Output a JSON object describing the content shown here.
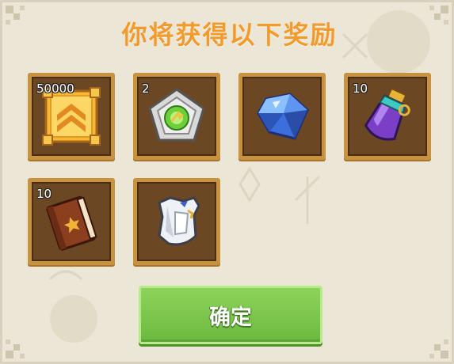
{
  "dialog": {
    "title": "你将获得以下奖励"
  },
  "rewards": [
    {
      "icon": "gold-insignia-icon",
      "count": "50000"
    },
    {
      "icon": "green-pentagon-gem-icon",
      "count": "2"
    },
    {
      "icon": "blue-crystal-icon",
      "count": ""
    },
    {
      "icon": "purple-potion-icon",
      "count": "10"
    },
    {
      "icon": "brown-book-icon",
      "count": "10"
    },
    {
      "icon": "white-armor-icon",
      "count": ""
    }
  ],
  "buttons": {
    "confirm_label": "确定"
  },
  "colors": {
    "title": "#f39a2c",
    "slot_border": "#c8923f",
    "slot_bg": "#6b4724",
    "confirm_bg": "#7cc64b"
  }
}
